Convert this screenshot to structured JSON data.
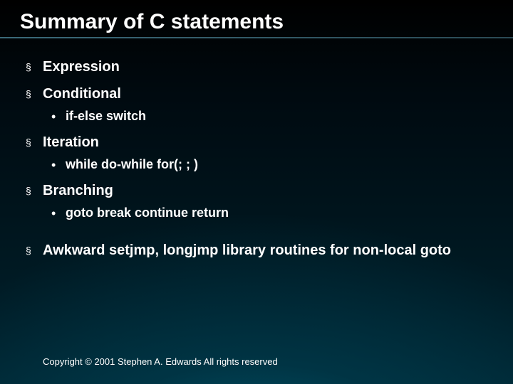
{
  "title": "Summary of C statements",
  "items": [
    {
      "label": "Expression",
      "sub": null
    },
    {
      "label": "Conditional",
      "sub": "if-else switch"
    },
    {
      "label": "Iteration",
      "sub": "while do-while for(; ; )"
    },
    {
      "label": "Branching",
      "sub": "goto break continue return"
    },
    {
      "label": "Awkward setjmp, longjmp library routines for non-local goto",
      "sub": null,
      "gap_before": true
    }
  ],
  "bullet_glyph": "§",
  "dot_glyph": "•",
  "copyright": "Copyright © 2001 Stephen A. Edwards  All rights reserved"
}
